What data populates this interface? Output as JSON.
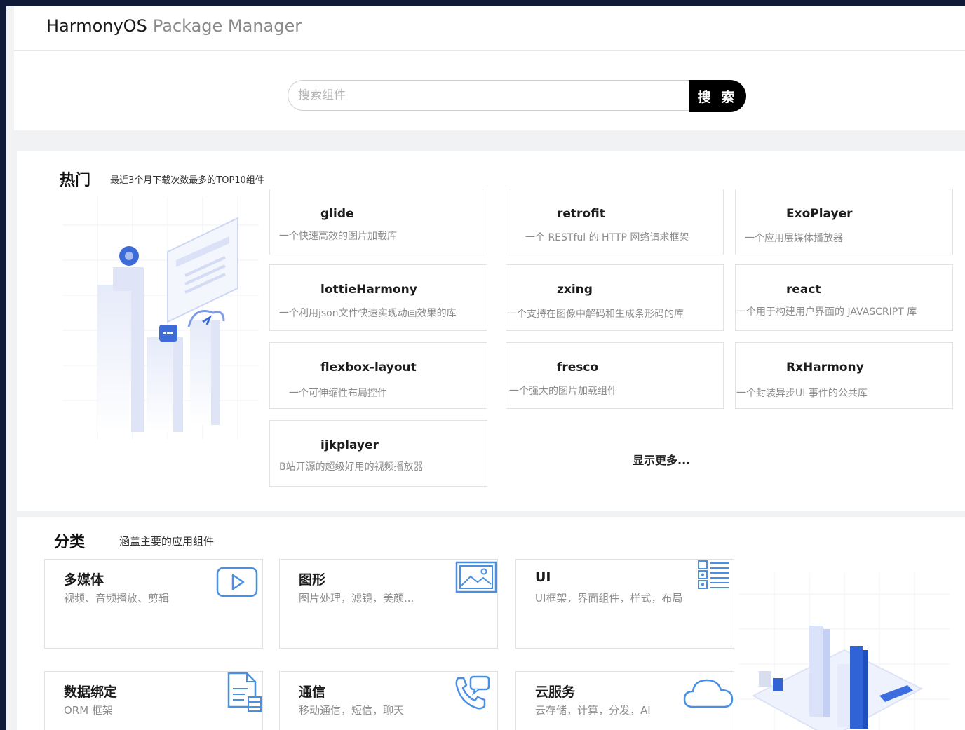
{
  "header": {
    "brand_main": "HarmonyOS",
    "brand_sub": "Package Manager"
  },
  "search": {
    "placeholder": "搜索组件",
    "button_label": "搜 索"
  },
  "hot": {
    "title": "热门",
    "subtitle": "最近3个月下载次数最多的TOP10组件",
    "packages": [
      {
        "name": "glide",
        "desc": "一个快速高效的图片加载库"
      },
      {
        "name": "retrofit",
        "desc": "一个 RESTful 的 HTTP 网络请求框架"
      },
      {
        "name": "ExoPlayer",
        "desc": "一个应用层媒体播放器"
      },
      {
        "name": "lottieHarmony",
        "desc": "一个利用json文件快速实现动画效果的库"
      },
      {
        "name": "zxing",
        "desc": "一个支持在图像中解码和生成条形码的库"
      },
      {
        "name": "react",
        "desc": "一个用于构建用户界面的 JAVASCRIPT 库"
      },
      {
        "name": "flexbox-layout",
        "desc": "一个可伸缩性布局控件"
      },
      {
        "name": "fresco",
        "desc": "一个强大的图片加载组件"
      },
      {
        "name": "RxHarmony",
        "desc": "一个封装异步UI 事件的公共库"
      },
      {
        "name": "ijkplayer",
        "desc": "B站开源的超级好用的视频播放器"
      }
    ],
    "show_more": "显示更多..."
  },
  "categories": {
    "title": "分类",
    "subtitle": "涵盖主要的应用组件",
    "items": [
      {
        "name": "多媒体",
        "desc": "视频、音频播放、剪辑",
        "icon": "play-icon"
      },
      {
        "name": "图形",
        "desc": "图片处理，滤镜，美颜...",
        "icon": "image-icon"
      },
      {
        "name": "UI",
        "desc": "UI框架，界面组件，样式，布局",
        "icon": "list-layout-icon"
      },
      {
        "name": "数据绑定",
        "desc": "ORM 框架",
        "icon": "document-icon"
      },
      {
        "name": "通信",
        "desc": "移动通信，短信，聊天",
        "icon": "phone-chat-icon"
      },
      {
        "name": "云服务",
        "desc": "云存储，计算，分发，AI",
        "icon": "cloud-icon"
      }
    ]
  },
  "colors": {
    "accent": "#4a90e2",
    "search_button": "#000000",
    "page_bg": "#f1f2f4",
    "outer_bg": "#0f1a38"
  }
}
